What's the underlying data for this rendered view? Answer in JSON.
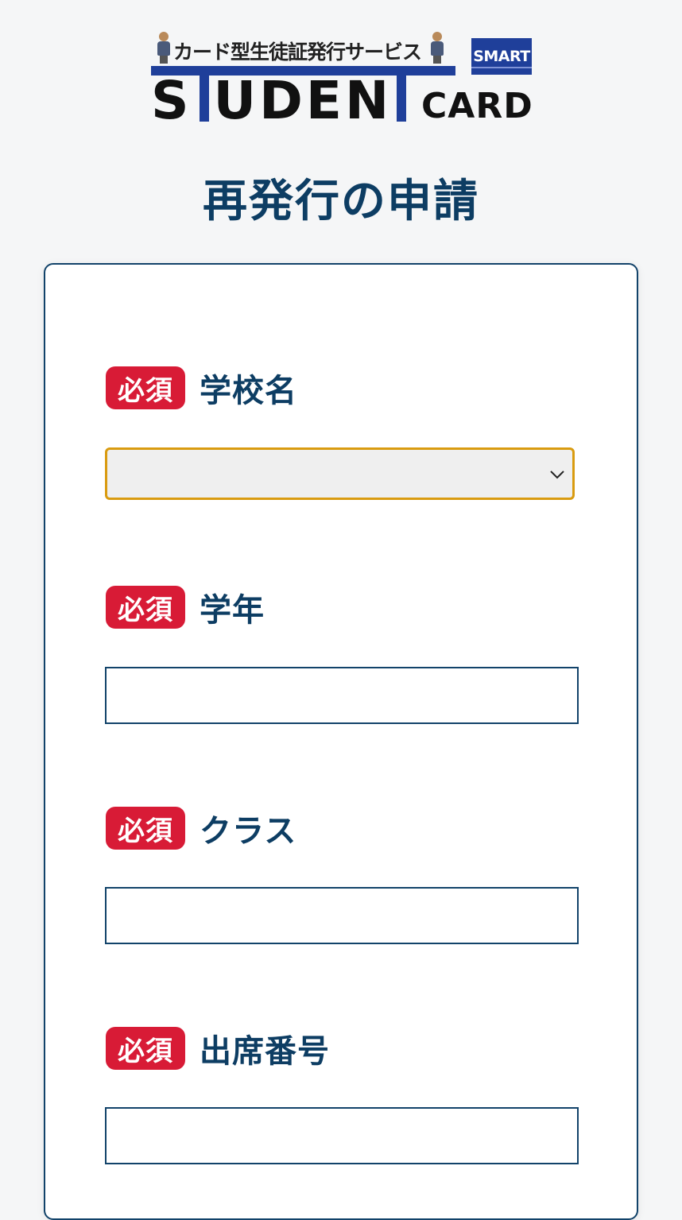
{
  "logo": {
    "tagline": "カード型生徒証発行サービス",
    "word": "S UDEN",
    "smart": "SMART",
    "card": "CARD"
  },
  "page_title": "再発行の申請",
  "form": {
    "fields": [
      {
        "required": "必須",
        "label": "学校名",
        "type": "select",
        "value": ""
      },
      {
        "required": "必須",
        "label": "学年",
        "type": "text",
        "value": ""
      },
      {
        "required": "必須",
        "label": "クラス",
        "type": "text",
        "value": ""
      },
      {
        "required": "必須",
        "label": "出席番号",
        "type": "text",
        "value": ""
      }
    ]
  },
  "colors": {
    "required_badge": "#d81b36",
    "title": "#0d3d63",
    "focus_border": "#d99b10",
    "logo_blue": "#1f3f9a"
  }
}
